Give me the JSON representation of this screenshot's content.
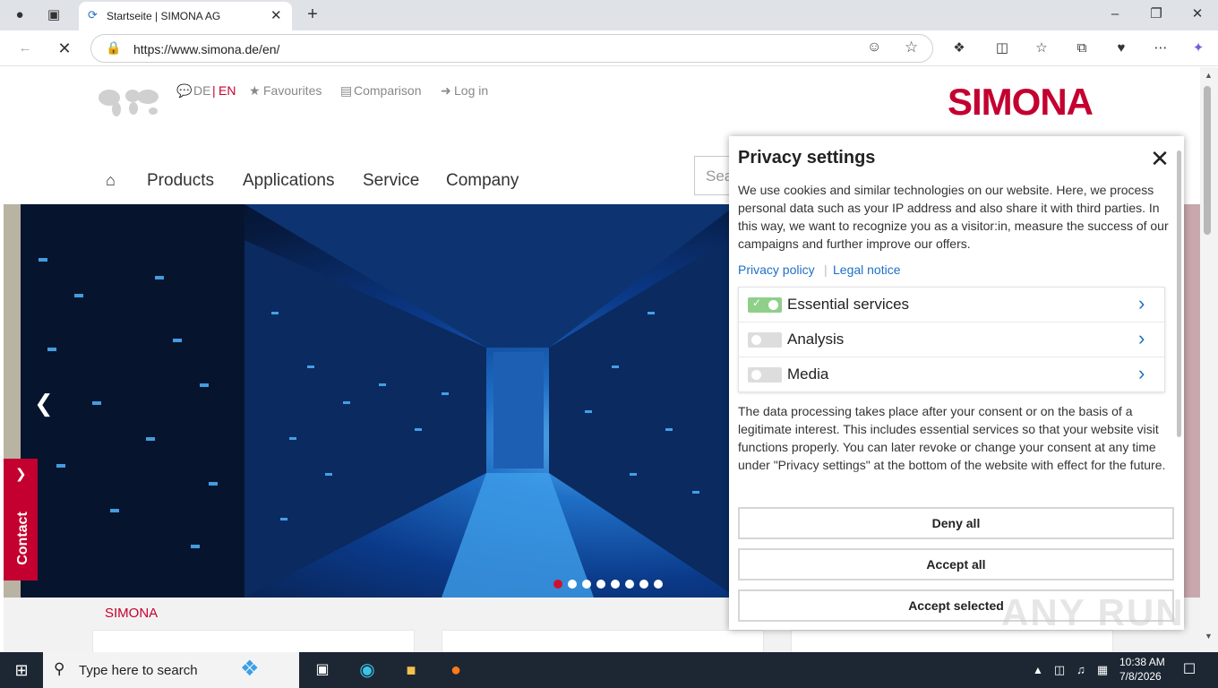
{
  "browser": {
    "tab_title": "Startseite | SIMONA AG",
    "url": "https://www.simona.de/en/",
    "new_tab_icon": "plus-icon",
    "minimize_icon": "minimize-icon",
    "restore_icon": "restore-icon",
    "close_icon": "close-icon"
  },
  "site": {
    "lang_de": "DE",
    "lang_sep": "|",
    "lang_en": "EN",
    "favourites": "Favourites",
    "comparison": "Comparison",
    "login": "Log in",
    "logo": "SIMONA",
    "nav": [
      "Products",
      "Applications",
      "Service",
      "Company"
    ],
    "search_placeholder": "Sea",
    "section_label": "SIMONA",
    "contact": "Contact",
    "slide_count": 8,
    "active_slide": 1
  },
  "privacy": {
    "title": "Privacy settings",
    "intro": "We use cookies and similar technologies on our website. Here, we process personal data such as your IP address and also share it with third parties. In this way, we want to recognize you as a visitor:in, measure the success of our campaigns and further improve our offers.",
    "privacy_policy": "Privacy policy",
    "legal_notice": "Legal notice",
    "services": [
      {
        "label": "Essential services",
        "enabled": true
      },
      {
        "label": "Analysis",
        "enabled": false
      },
      {
        "label": "Media",
        "enabled": false
      }
    ],
    "body": "The data processing takes place after your consent or on the basis of a legitimate interest. This includes essential services so that your website visit functions properly. You can later revoke or change your consent at any time under \"Privacy settings\" at the bottom of the website with effect for the future.",
    "deny_all": "Deny all",
    "accept_all": "Accept all",
    "accept_selected": "Accept selected"
  },
  "taskbar": {
    "search_placeholder": "Type here to search",
    "time": "10:38 AM",
    "date": "7/8/2026"
  },
  "watermark": "ANY RUN"
}
